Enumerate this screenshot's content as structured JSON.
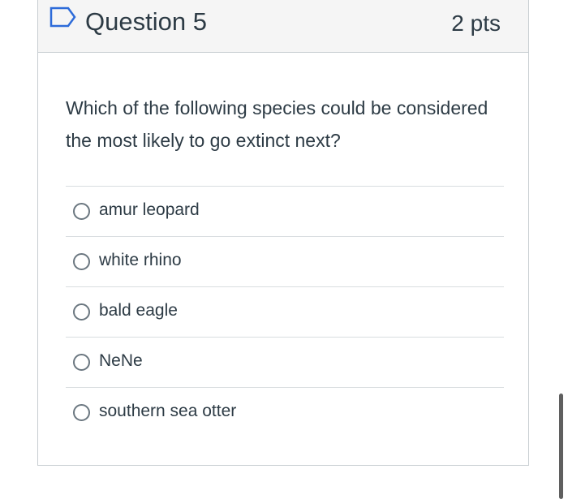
{
  "question": {
    "title": "Question 5",
    "points": "2 pts",
    "flag_icon": "flag-outline-icon",
    "text": "Which of the following species could be considered the most likely to go extinct next?"
  },
  "answers": [
    {
      "label": "amur leopard",
      "selected": false
    },
    {
      "label": "white rhino",
      "selected": false
    },
    {
      "label": "bald eagle",
      "selected": false
    },
    {
      "label": "NeNe",
      "selected": false
    },
    {
      "label": "southern sea otter",
      "selected": false
    }
  ],
  "colors": {
    "text": "#2d3b45",
    "header_bg": "#f5f5f5",
    "border": "#c7cdd1",
    "flag": "#2d6bd9",
    "radio_border": "#6b7780"
  }
}
